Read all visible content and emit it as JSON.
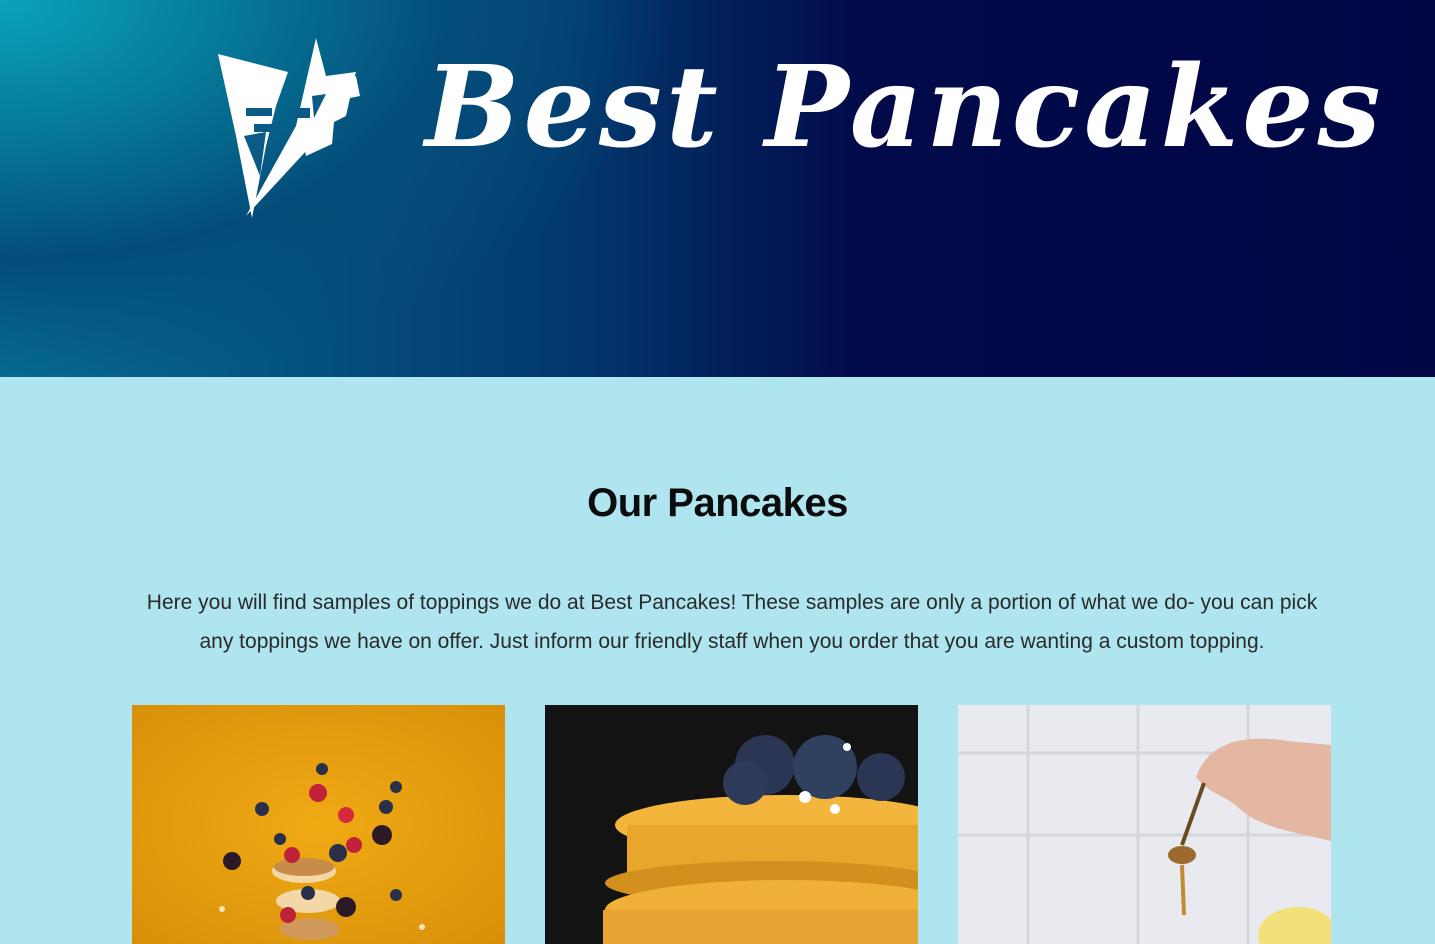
{
  "header": {
    "brand_name": "Best Pancakes",
    "logo_icon": "kite-logo-icon",
    "gradient_colors": [
      "#0aa3bd",
      "#03386c",
      "#010745"
    ]
  },
  "main": {
    "section_title": "Our Pancakes",
    "intro_text": "Here you will find samples of toppings we do at Best Pancakes! These samples are only a portion of what we do- you can pick any toppings we have on offer. Just inform our friendly staff when you order that you are wanting a custom topping.",
    "background_color": "#aee5ef",
    "cards": [
      {
        "image": "pancake-berries-photo",
        "background": "#e8a00f"
      },
      {
        "image": "pancake-blueberries-syrup-photo",
        "background": "#111111"
      },
      {
        "image": "honey-spoon-photo",
        "background": "#e9eaef"
      }
    ]
  }
}
